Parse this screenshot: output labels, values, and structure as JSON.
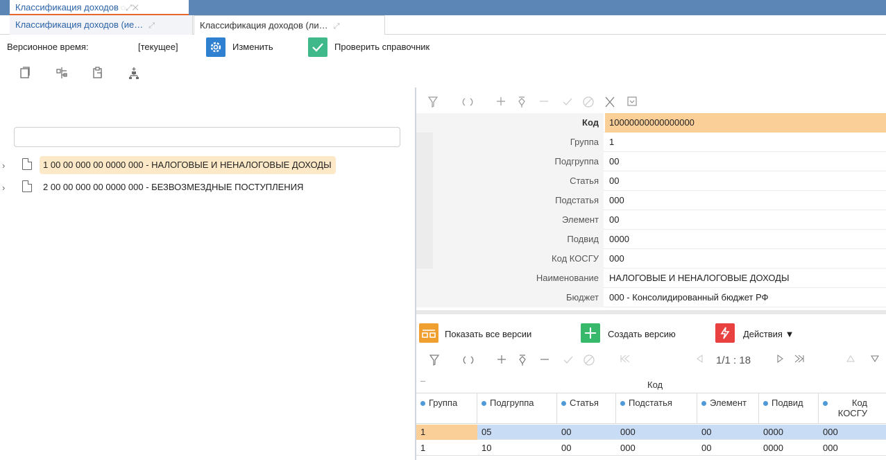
{
  "window_tab": {
    "title": "Классификация доходов",
    "controls": "◌⤢✕"
  },
  "subtabs": [
    {
      "label": "Классификация доходов (ие…",
      "ctl": "⤢"
    },
    {
      "label": "Классификация доходов (ли…",
      "ctl": "⤢"
    }
  ],
  "version_row": {
    "label": "Версионное время:",
    "value": "[текущее]",
    "change_button": "Изменить",
    "check_button": "Проверить справочник",
    "colors": {
      "gear": "#2f80d1",
      "check": "#3fb88a"
    }
  },
  "left_toolbar_icons": [
    "copy-icon",
    "insert-sibling-icon",
    "paste-icon",
    "add-child-icon"
  ],
  "search": {
    "value": "",
    "placeholder": ""
  },
  "tree": [
    {
      "label": "1 00 00 000 00 0000 000 - НАЛОГОВЫЕ И НЕНАЛОГОВЫЕ ДОХОДЫ",
      "selected": true
    },
    {
      "label": "2 00 00 000 00 0000 000 - БЕЗВОЗМЕЗДНЫЕ ПОСТУПЛЕНИЯ",
      "selected": false
    }
  ],
  "record_toolbar_icons": [
    "filter-icon",
    "refresh-icon",
    "add-icon",
    "edit-icon",
    "remove-icon",
    "confirm-icon",
    "cancel-icon",
    "clear-icon",
    "collapse-icon"
  ],
  "form": {
    "fields": [
      {
        "label": "Код",
        "value": "10000000000000000"
      },
      {
        "label": "Группа",
        "value": "1"
      },
      {
        "label": "Подгруппа",
        "value": "00"
      },
      {
        "label": "Статья",
        "value": "00"
      },
      {
        "label": "Подстатья",
        "value": "000"
      },
      {
        "label": "Элемент",
        "value": "00"
      },
      {
        "label": "Подвид",
        "value": "0000"
      },
      {
        "label": "Код КОСГУ",
        "value": "000"
      },
      {
        "label": "Наименование",
        "value": "НАЛОГОВЫЕ И НЕНАЛОГОВЫЕ ДОХОДЫ"
      },
      {
        "label": "Бюджет",
        "value": "000 - Консолидированный бюджет РФ"
      }
    ]
  },
  "versions": {
    "show_all": "Показать все версии",
    "create": "Создать версию",
    "actions": "Действия ▼",
    "colors": {
      "show_all": "#f0a030",
      "create": "#37b86b",
      "actions": "#e94040"
    },
    "pager": "1/1 : 18",
    "grid": {
      "group_header": "Код",
      "columns": [
        "Группа",
        "Подгруппа",
        "Статья",
        "Подстатья",
        "Элемент",
        "Подвид",
        "Код КОСГУ"
      ],
      "rows": [
        [
          "1",
          "05",
          "00",
          "000",
          "00",
          "0000",
          "000"
        ],
        [
          "1",
          "10",
          "00",
          "000",
          "00",
          "0000",
          "000"
        ]
      ]
    }
  }
}
